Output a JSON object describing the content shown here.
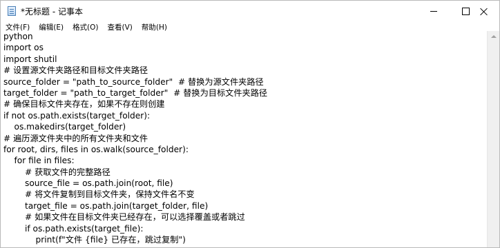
{
  "window": {
    "title": "*无标题 - 记事本",
    "icon": "notepad-icon"
  },
  "menu": [
    "文件(F)",
    "编辑(E)",
    "格式(O)",
    "查看(V)",
    "帮助(H)"
  ],
  "editor": {
    "lines": [
      "python",
      "import os",
      "import shutil",
      "# 设置源文件夹路径和目标文件夹路径",
      "source_folder = \"path_to_source_folder\"  # 替换为源文件夹路径",
      "target_folder = \"path_to_target_folder\"  # 替换为目标文件夹路径",
      "# 确保目标文件夹存在，如果不存在则创建",
      "if not os.path.exists(target_folder):",
      "    os.makedirs(target_folder)",
      "# 遍历源文件夹中的所有文件夹和文件",
      "for root, dirs, files in os.walk(source_folder):",
      "    for file in files:",
      "        # 获取文件的完整路径",
      "        source_file = os.path.join(root, file)",
      "        # 将文件复制到目标文件夹，保持文件名不变",
      "        target_file = os.path.join(target_folder, file)",
      "        # 如果文件在目标文件夹已经存在，可以选择覆盖或者跳过",
      "        if os.path.exists(target_file):",
      "            print(f\"文件 {file} 已存在，跳过复制\")"
    ]
  }
}
